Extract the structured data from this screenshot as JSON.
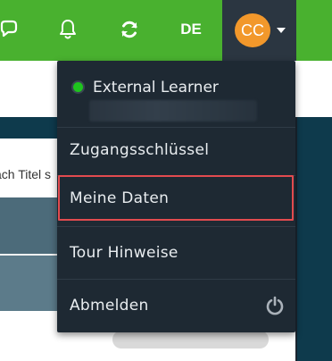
{
  "topbar": {
    "language": "DE",
    "icons": [
      "chat-icon",
      "bell-icon",
      "refresh-icon"
    ],
    "user": {
      "initials": "CC",
      "avatar_color": "#f2982b"
    }
  },
  "background": {
    "search_fragment": "ach Titel s"
  },
  "user_menu": {
    "status_color": "#1ec41e",
    "username": "External Learner",
    "items": [
      {
        "label": "Zugangsschlüssel"
      },
      {
        "label": "Meine Daten",
        "highlighted": true
      },
      {
        "label": "Tour Hinweise"
      },
      {
        "label": "Abmelden",
        "icon": "power-icon"
      }
    ]
  },
  "colors": {
    "topbar": "#49b12f",
    "menu_bg": "#1e2933",
    "highlight_border": "#e24b4f"
  }
}
